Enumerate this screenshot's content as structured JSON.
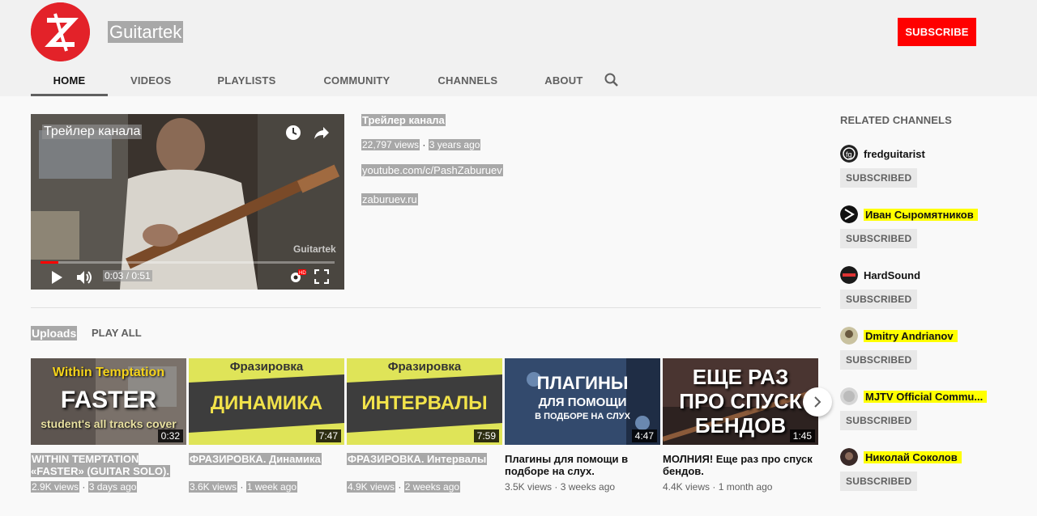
{
  "channel": {
    "name": "Guitartek",
    "subscribe_label": "SUBSCRIBE"
  },
  "tabs": [
    {
      "label": "HOME"
    },
    {
      "label": "VIDEOS"
    },
    {
      "label": "PLAYLISTS"
    },
    {
      "label": "COMMUNITY"
    },
    {
      "label": "CHANNELS"
    },
    {
      "label": "ABOUT"
    }
  ],
  "trailer": {
    "player_title": "Трейлер канала",
    "time": "0:03 / 0:51",
    "progress_fraction": 0.06,
    "watermark": "Guitartek",
    "title": "Трейлер канала",
    "views": "22,797 views",
    "age": "3 years ago",
    "link1": "youtube.com/c/PashZaburuev",
    "link2": "zaburuev.ru"
  },
  "uploads": {
    "label": "Uploads",
    "play_all": "PLAY ALL",
    "videos": [
      {
        "thumb_lines": [
          "Within Temptation",
          "FASTER",
          "student's all tracks cover"
        ],
        "duration": "0:32",
        "title": "WITHIN TEMPTATION «FASTER» (GUITAR SOLO).",
        "views": "2.9K views",
        "age": "3 days ago"
      },
      {
        "thumb_lines": [
          "Фразировка",
          "ДИНАМИКА"
        ],
        "duration": "7:47",
        "title": "ФРАЗИРОВКА. Динамика",
        "views": "3.6K views",
        "age": "1 week ago"
      },
      {
        "thumb_lines": [
          "Фразировка",
          "ИНТЕРВАЛЫ"
        ],
        "duration": "7:59",
        "title": "ФРАЗИРОВКА. Интервалы",
        "views": "4.9K views",
        "age": "2 weeks ago"
      },
      {
        "thumb_lines": [
          "ПЛАГИНЫ",
          "ДЛЯ ПОМОЩИ",
          "В ПОДБОРЕ НА СЛУХ"
        ],
        "duration": "4:47",
        "title": "Плагины для помощи в подборе на слух.",
        "views": "3.5K views",
        "age": "3 weeks ago"
      },
      {
        "thumb_lines": [
          "ЕЩЕ РАЗ",
          "ПРО СПУСК",
          "БЕНДОВ"
        ],
        "duration": "1:45",
        "title": "МОЛНИЯ! Еще раз про спуск бендов.",
        "views": "4.4K views",
        "age": "1 month ago"
      }
    ]
  },
  "related": {
    "heading": "RELATED CHANNELS",
    "subscribed_label": "SUBSCRIBED",
    "channels": [
      {
        "name": "fredguitarist",
        "highlight": false
      },
      {
        "name": "Иван Сыромятников",
        "highlight": true
      },
      {
        "name": "HardSound",
        "highlight": false
      },
      {
        "name": "Dmitry Andrianov",
        "highlight": true
      },
      {
        "name": "MJTV Official Commu...",
        "highlight": true
      },
      {
        "name": "Николай Соколов",
        "highlight": true
      }
    ]
  },
  "colors": {
    "subscribe": "#ff0000",
    "highlight": "#ffff00"
  }
}
